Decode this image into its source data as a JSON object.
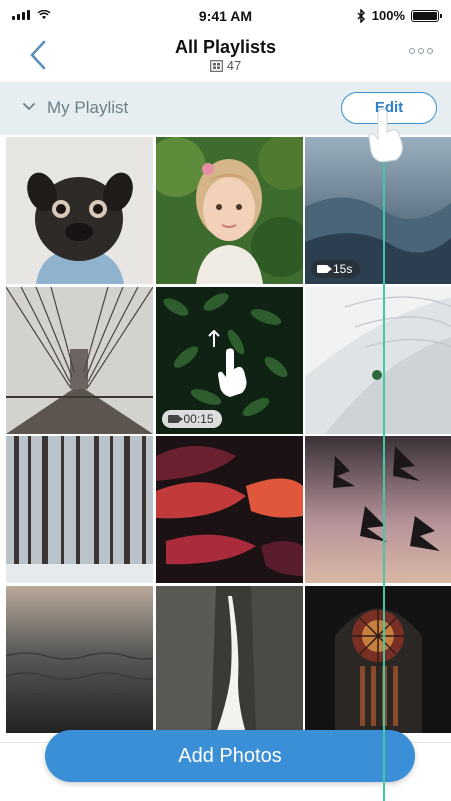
{
  "status_bar": {
    "time": "9:41 AM",
    "battery": "100%"
  },
  "nav": {
    "title": "All Playlists",
    "count": "47"
  },
  "section": {
    "label": "My Playlist",
    "edit_label": "Edit"
  },
  "tiles": [
    {
      "name": "pug-photo",
      "kind": "photo"
    },
    {
      "name": "girl-photo",
      "kind": "photo"
    },
    {
      "name": "ocean-waves-video",
      "kind": "video",
      "duration": "15s"
    },
    {
      "name": "bridge-photo",
      "kind": "photo"
    },
    {
      "name": "leaves-video",
      "kind": "video",
      "duration": "00:15"
    },
    {
      "name": "white-architecture-photo",
      "kind": "photo"
    },
    {
      "name": "snowy-forest-photo",
      "kind": "photo"
    },
    {
      "name": "red-abstract-photo",
      "kind": "photo"
    },
    {
      "name": "tree-sunset-photo",
      "kind": "photo"
    },
    {
      "name": "sea-photo",
      "kind": "photo"
    },
    {
      "name": "waterfall-photo",
      "kind": "photo"
    },
    {
      "name": "cathedral-window-photo",
      "kind": "photo"
    }
  ],
  "actions": {
    "add_photos": "Add Photos"
  },
  "colors": {
    "accent": "#3a8fd6",
    "section_bg": "#e7eef1",
    "guide_line": "#41c8a5"
  }
}
